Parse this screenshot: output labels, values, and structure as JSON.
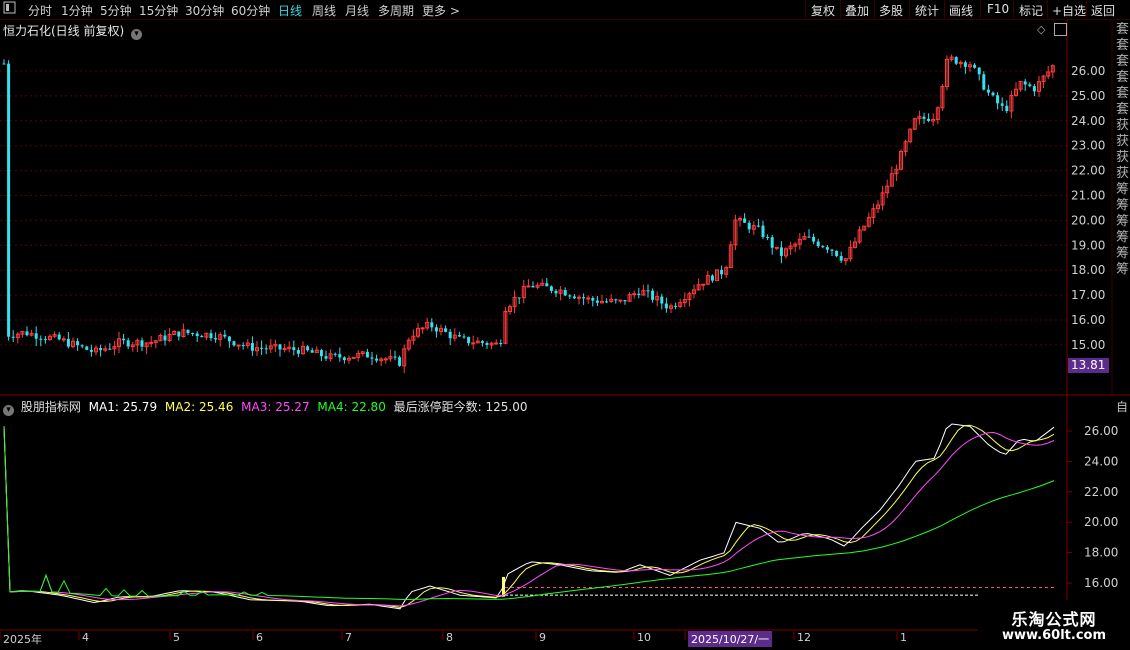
{
  "toolbar": {
    "left_items": [
      "分时",
      "1分钟",
      "5分钟",
      "15分钟",
      "30分钟",
      "60分钟",
      "日线",
      "周线",
      "月线",
      "多周期",
      "更多 >"
    ],
    "active": "日线",
    "right_items": [
      "复权",
      "叠加",
      "多股",
      "统计",
      "画线",
      "F10",
      "标记",
      "+自选",
      "返回"
    ]
  },
  "main_panel": {
    "title": "恒力石化(日线 前复权)",
    "y_ticks": [
      "26.00",
      "25.00",
      "24.00",
      "23.00",
      "22.00",
      "21.00",
      "20.00",
      "19.00",
      "18.00",
      "17.00",
      "16.00",
      "15.00"
    ],
    "price_tag": "13.81",
    "side_label_chars": [
      "套",
      "套",
      "套",
      "套",
      "套",
      "套",
      "获",
      "获",
      "获",
      "获",
      "筹",
      "筹",
      "筹",
      "筹",
      "筹",
      "筹"
    ]
  },
  "indicator_panel": {
    "name": "股朋指标网",
    "ma1": "MA1: 25.79",
    "ma2": "MA2: 25.46",
    "ma3": "MA3: 25.27",
    "ma4": "MA4: 22.80",
    "last": "最后涨停距今数: 125.00",
    "y_ticks": [
      "26.00",
      "24.00",
      "22.00",
      "20.00",
      "18.00",
      "16.00"
    ],
    "corner_label": "自"
  },
  "time_axis": {
    "labels": [
      "2025年",
      "4",
      "5",
      "6",
      "7",
      "8",
      "9",
      "10",
      "2025/10/27/一",
      "12",
      "1"
    ]
  },
  "watermark": {
    "line1": "乐淘公式网",
    "line2": "www.60lt.com"
  },
  "colors": {
    "up": "#ff3c3c",
    "down": "#35e0f0",
    "ma1": "#ffffff",
    "ma2": "#ffff55",
    "ma3": "#ff4bff",
    "ma4": "#22ff22",
    "cursor_tag": "#6a2a9a"
  }
}
